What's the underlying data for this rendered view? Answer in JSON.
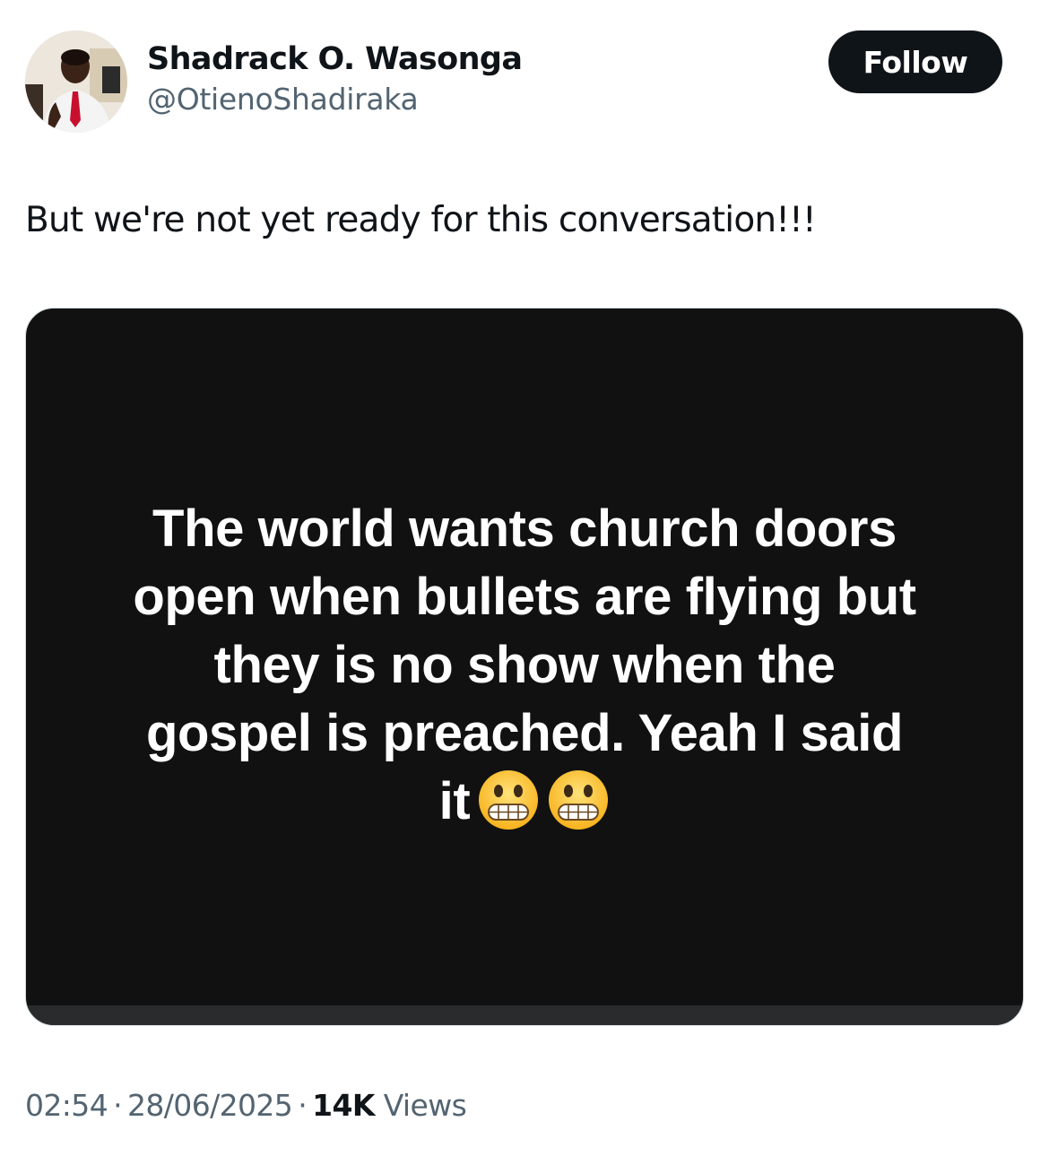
{
  "author": {
    "display_name": "Shadrack O. Wasonga",
    "handle": "@OtienoShadiraka",
    "avatar_icon": "profile-photo"
  },
  "follow_button": {
    "label": "Follow"
  },
  "tweet": {
    "text": "But we're not yet ready for this conversation!!!"
  },
  "media": {
    "lines": [
      "The world wants church doors",
      "open when bullets are flying but",
      "they is no show when the",
      "gospel is preached. Yeah I said",
      "it"
    ],
    "emojis": [
      "grimacing-face-emoji",
      "grimacing-face-emoji"
    ]
  },
  "meta": {
    "time": "02:54",
    "date": "28/06/2025",
    "separator": "·",
    "views_count": "14K",
    "views_label": "Views"
  },
  "colors": {
    "text_primary": "#0f1419",
    "text_secondary": "#536471",
    "button_bg": "#0f1419",
    "media_bg": "#111111"
  }
}
